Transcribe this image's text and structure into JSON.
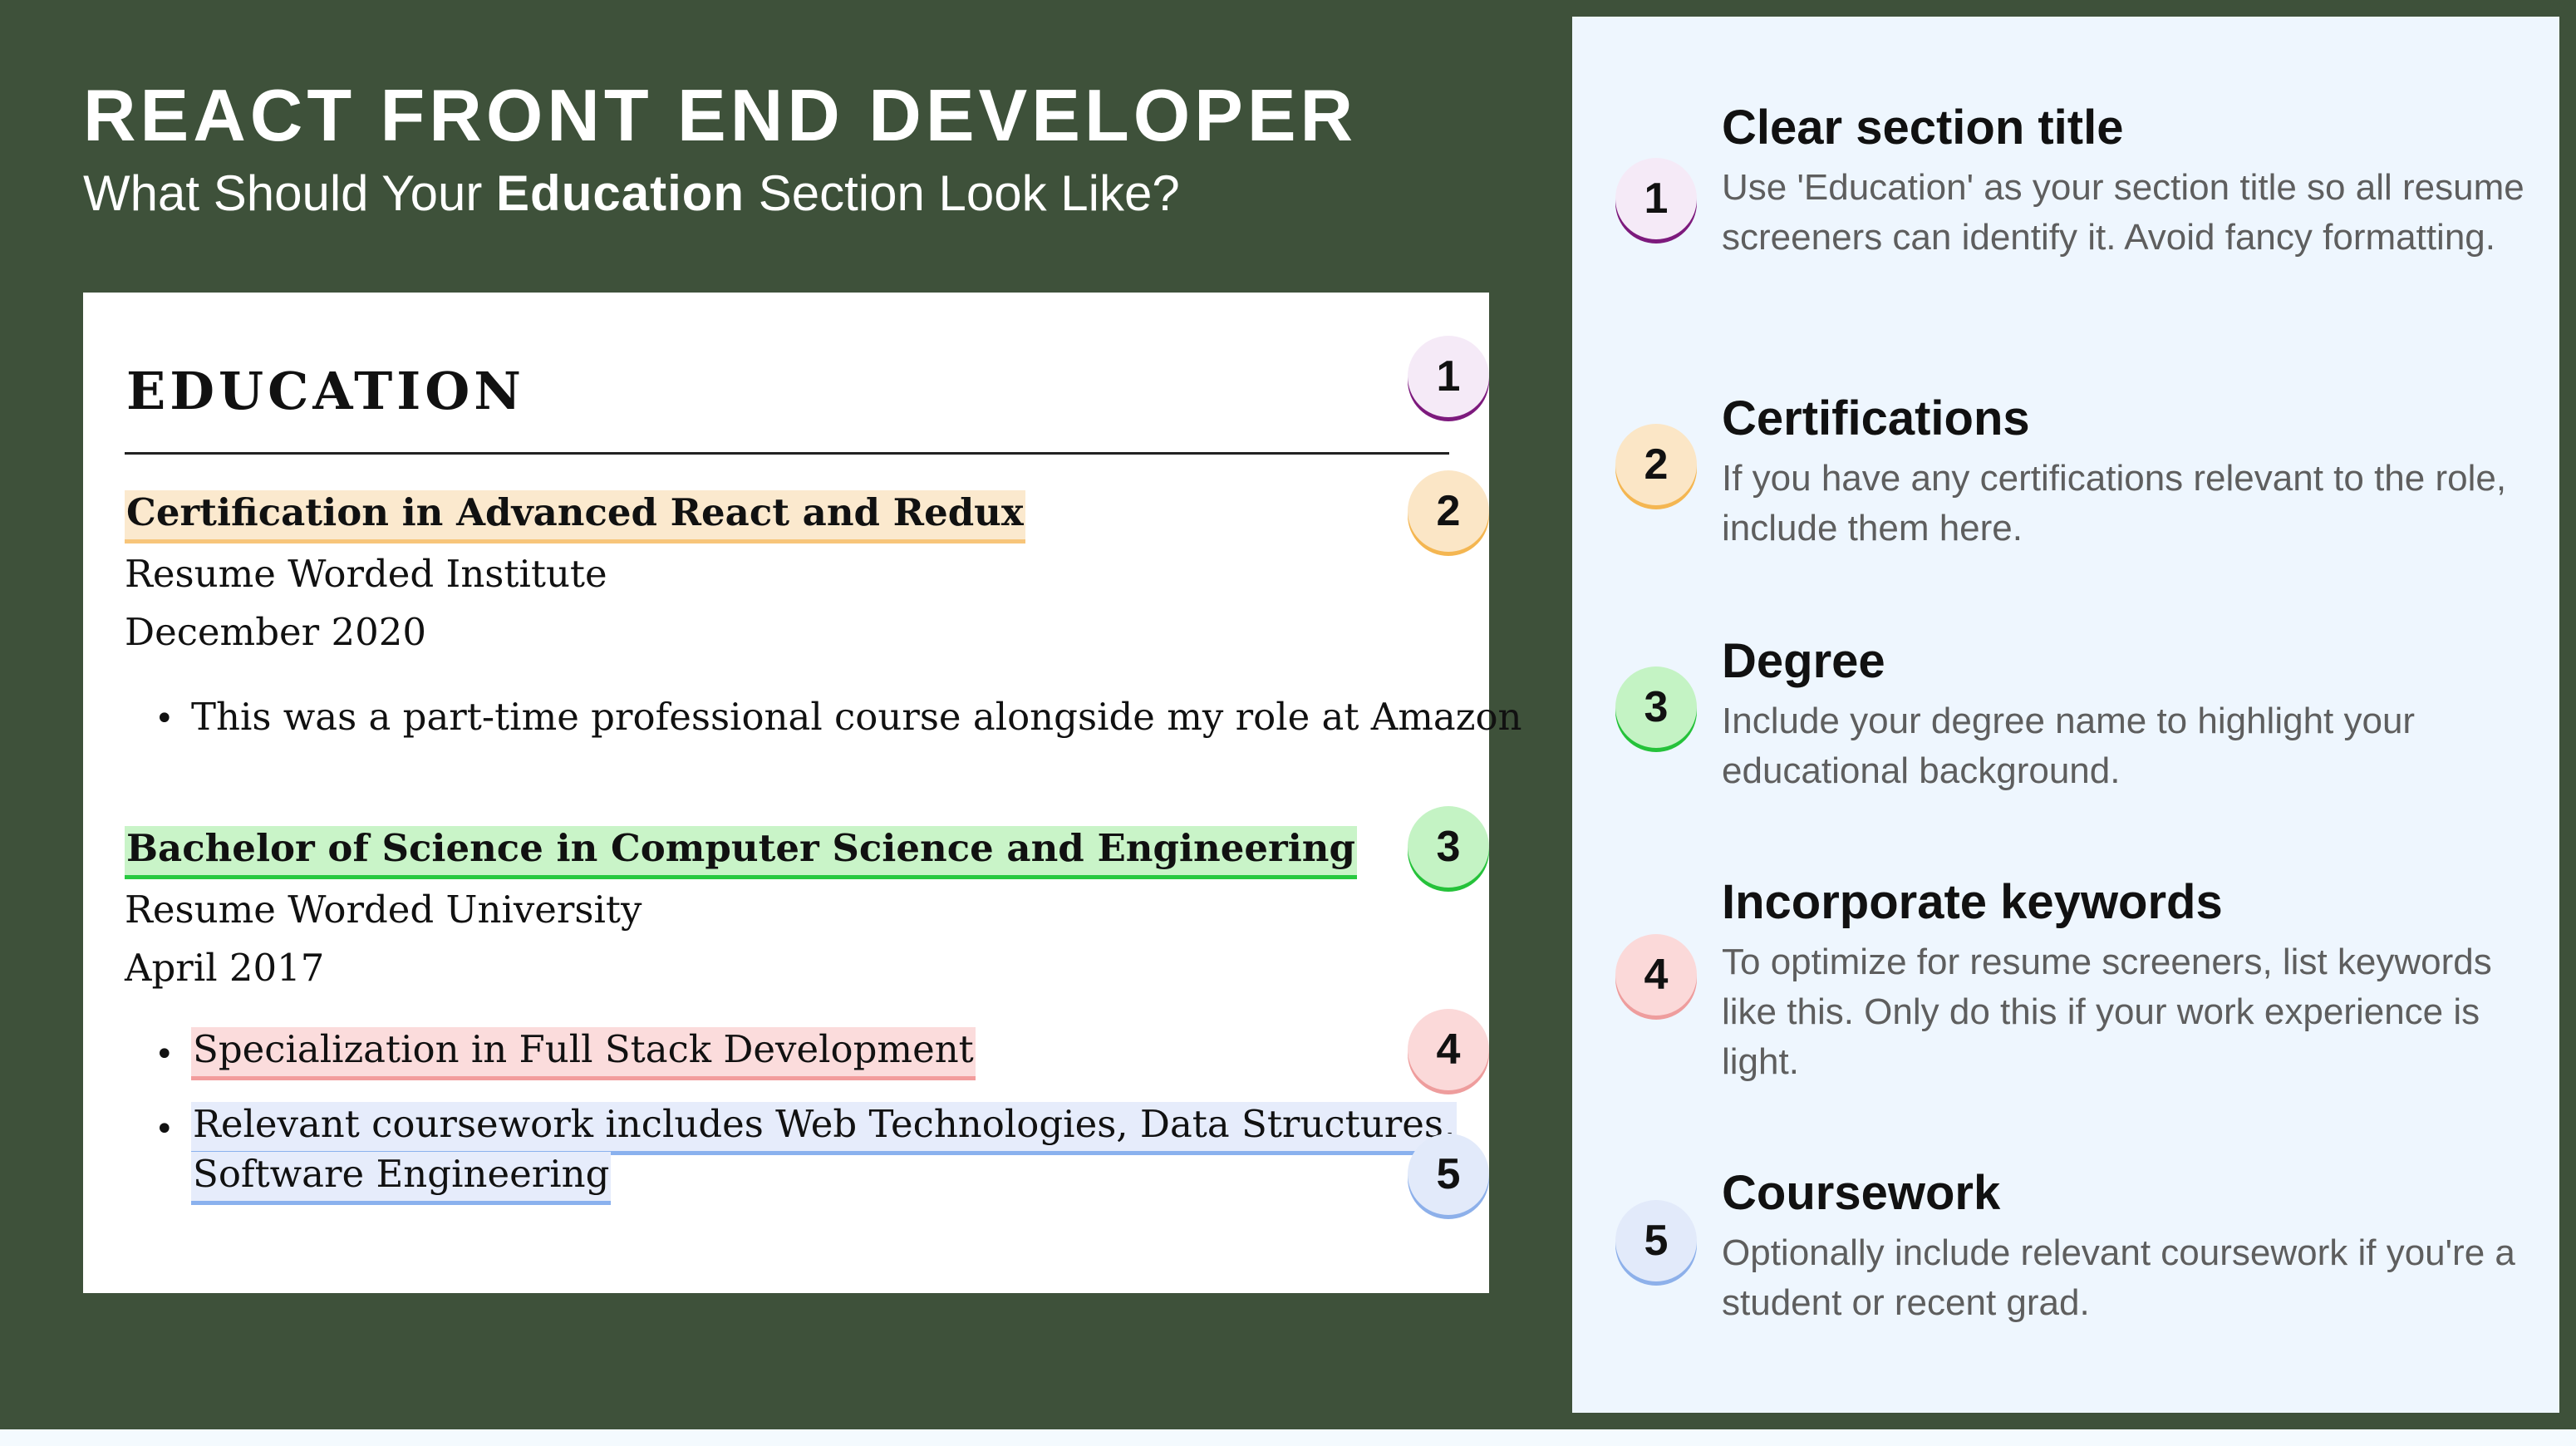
{
  "header": {
    "title": "REACT FRONT END DEVELOPER",
    "subtitle_before": "What Should Your ",
    "subtitle_bold": "Education",
    "subtitle_after": " Section Look Like?"
  },
  "resume": {
    "heading": "EDUCATION",
    "entries": [
      {
        "title": "Certification in Advanced React and Redux",
        "institution": "Resume Worded Institute",
        "date": "December 2020",
        "bullets": [
          "This was a part-time professional course alongside my role at Amazon"
        ]
      },
      {
        "title": "Bachelor of Science in Computer Science and Engineering",
        "institution": "Resume Worded University",
        "date": "April 2017",
        "bullets": [
          "Specialization in Full Stack Development",
          "Relevant coursework includes Web Technologies, Data Structures,",
          "Software Engineering"
        ]
      }
    ],
    "bullet_glyph": "•"
  },
  "badges": [
    "1",
    "2",
    "3",
    "4",
    "5"
  ],
  "tips": [
    {
      "number": "1",
      "title": "Clear section title",
      "description": "Use 'Education' as your section title so all resume screeners can identify it. Avoid fancy formatting."
    },
    {
      "number": "2",
      "title": "Certifications",
      "description": "If you have any certifications relevant to the role, include them here."
    },
    {
      "number": "3",
      "title": "Degree",
      "description": "Include your degree name to highlight your educational background."
    },
    {
      "number": "4",
      "title": "Incorporate keywords",
      "description": "To optimize for resume screeners, list keywords like this. Only do this if your work experience is light."
    },
    {
      "number": "5",
      "title": "Coursework",
      "description": "Optionally include relevant coursework if you're a student or recent grad."
    }
  ],
  "colors": {
    "background": "#3e513a",
    "panel": "#eef6fe",
    "badge_1": "#7d1a7d",
    "badge_2": "#f4b651",
    "badge_3": "#25c23a",
    "badge_4": "#ee9d9d",
    "badge_5": "#8db0ea"
  }
}
